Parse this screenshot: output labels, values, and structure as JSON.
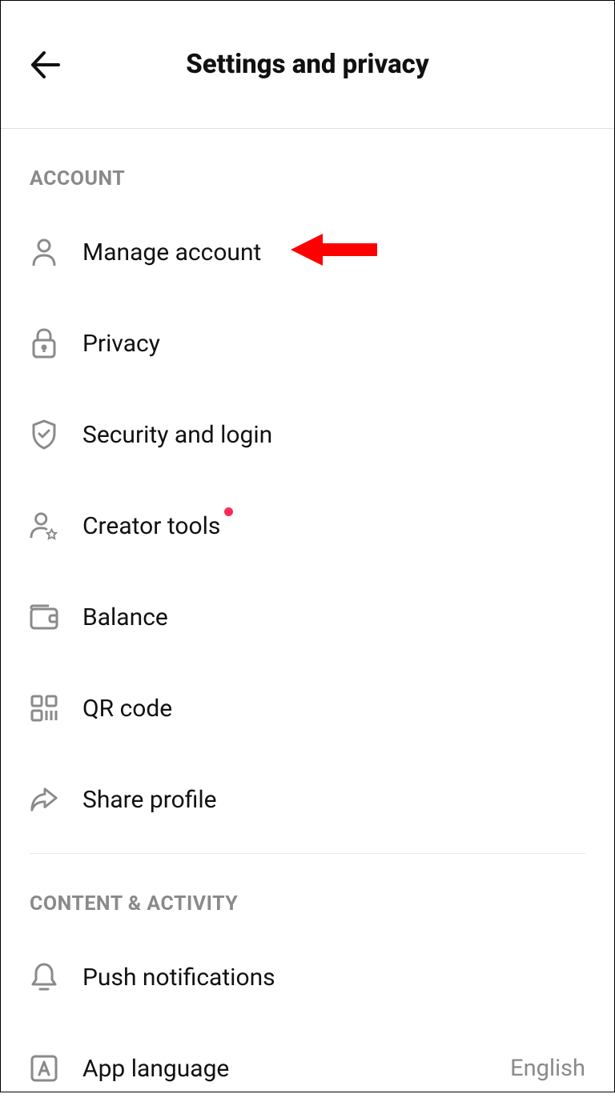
{
  "header": {
    "title": "Settings and privacy"
  },
  "sections": {
    "account": {
      "header": "ACCOUNT",
      "items": {
        "manage_account": {
          "label": "Manage account"
        },
        "privacy": {
          "label": "Privacy"
        },
        "security": {
          "label": "Security and login"
        },
        "creator_tools": {
          "label": "Creator tools",
          "has_notification": true
        },
        "balance": {
          "label": "Balance"
        },
        "qr_code": {
          "label": "QR code"
        },
        "share_profile": {
          "label": "Share profile"
        }
      }
    },
    "content_activity": {
      "header": "CONTENT & ACTIVITY",
      "items": {
        "push_notifications": {
          "label": "Push notifications"
        },
        "app_language": {
          "label": "App language",
          "value": "English"
        }
      }
    }
  }
}
